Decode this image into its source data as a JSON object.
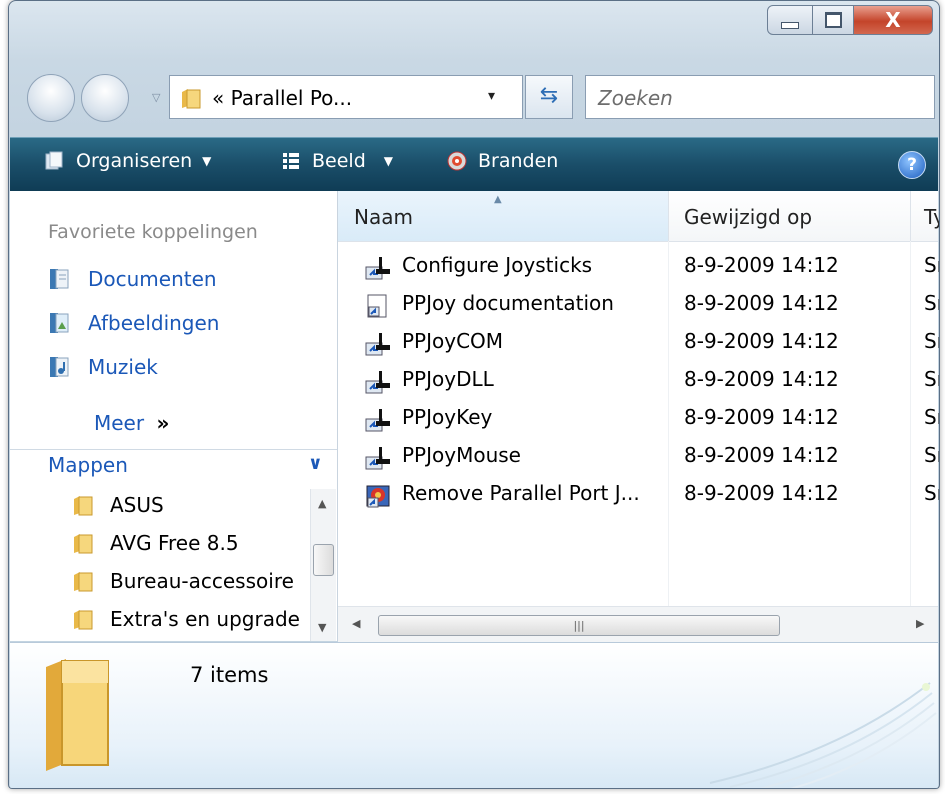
{
  "window": {
    "caption_buttons": {
      "minimize": "minimize",
      "maximize": "maximize",
      "close": "X"
    }
  },
  "address": {
    "breadcrumb": "« Parallel Po...",
    "dropdown_arrow": "▾"
  },
  "search": {
    "placeholder": "Zoeken"
  },
  "toolbar": {
    "organize": "Organiseren",
    "view": "Beeld",
    "burn": "Branden",
    "help": "?"
  },
  "favorites": {
    "title": "Favoriete koppelingen",
    "items": [
      {
        "label": "Documenten",
        "icon": "documents-icon"
      },
      {
        "label": "Afbeeldingen",
        "icon": "pictures-icon"
      },
      {
        "label": "Muziek",
        "icon": "music-icon"
      }
    ],
    "more": "Meer",
    "more_glyph": "»"
  },
  "folders": {
    "title": "Mappen",
    "items": [
      "ASUS",
      "AVG Free 8.5",
      "Bureau-accessoire",
      "Extra's en upgrade"
    ]
  },
  "columns": {
    "name": "Naam",
    "modified": "Gewijzigd op",
    "type": "Ty"
  },
  "files": [
    {
      "name": "Configure Joysticks",
      "date": "8-9-2009 14:12",
      "type": "Sn"
    },
    {
      "name": "PPJoy documentation",
      "date": "8-9-2009 14:12",
      "type": "Sn"
    },
    {
      "name": "PPJoyCOM",
      "date": "8-9-2009 14:12",
      "type": "Sn"
    },
    {
      "name": "PPJoyDLL",
      "date": "8-9-2009 14:12",
      "type": "Sn"
    },
    {
      "name": "PPJoyKey",
      "date": "8-9-2009 14:12",
      "type": "Sn"
    },
    {
      "name": "PPJoyMouse",
      "date": "8-9-2009 14:12",
      "type": "Sn"
    },
    {
      "name": "Remove Parallel Port J...",
      "date": "8-9-2009 14:12",
      "type": "Sn"
    }
  ],
  "details": {
    "count": "7 items"
  },
  "colors": {
    "toolbar": "#1a4e69",
    "link": "#1b58b8",
    "close": "#c4442a"
  }
}
